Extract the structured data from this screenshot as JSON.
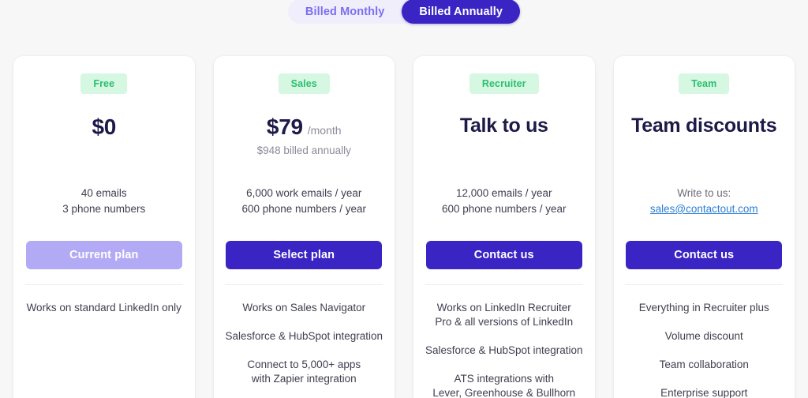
{
  "billing_toggle": {
    "options": [
      {
        "label": "Billed Monthly",
        "active": false
      },
      {
        "label": "Billed Annually",
        "active": true
      }
    ]
  },
  "colors": {
    "page_background": "#f7f7f8",
    "card_background": "#ffffff",
    "accent_primary": "#3a24c4",
    "accent_muted": "#b3aaf5",
    "badge_background": "#d6f7e2",
    "badge_text": "#2bbf6e",
    "heading_text": "#1d1a47",
    "body_text": "#3f3f50",
    "muted_text": "#8b8b99",
    "link": "#2b7fd4",
    "toggle_track": "#f0eefb",
    "toggle_inactive_text": "#7b6ff0",
    "divider": "#ededf1"
  },
  "plans": [
    {
      "badge": "Free",
      "price": "$0",
      "price_suffix": "",
      "price_sub": "",
      "quota_lines": [
        "40 emails",
        "3 phone numbers"
      ],
      "quota_note": "",
      "quota_link": "",
      "cta_label": "Current plan",
      "cta_state": "current",
      "features": [
        "Works on standard LinkedIn only"
      ]
    },
    {
      "badge": "Sales",
      "price": "$79",
      "price_suffix": "/month",
      "price_sub": "$948 billed annually",
      "quota_lines": [
        "6,000 work emails / year",
        "600 phone numbers / year"
      ],
      "quota_note": "",
      "quota_link": "",
      "cta_label": "Select plan",
      "cta_state": "primary",
      "features": [
        "Works on Sales Navigator",
        "Salesforce & HubSpot integration",
        "Connect to 5,000+ apps\nwith Zapier integration"
      ]
    },
    {
      "badge": "Recruiter",
      "price": "Talk to us",
      "price_suffix": "",
      "price_sub": "",
      "quota_lines": [
        "12,000 emails / year",
        "600 phone numbers / year"
      ],
      "quota_note": "",
      "quota_link": "",
      "cta_label": "Contact us",
      "cta_state": "primary",
      "features": [
        "Works on LinkedIn Recruiter\nPro & all versions of LinkedIn",
        "Salesforce & HubSpot integration",
        "ATS integrations with\nLever, Greenhouse & Bullhorn"
      ]
    },
    {
      "badge": "Team",
      "price": "Team discounts",
      "price_suffix": "",
      "price_sub": "",
      "quota_lines": [],
      "quota_note": "Write to us:",
      "quota_link": "sales@contactout.com",
      "cta_label": "Contact us",
      "cta_state": "primary",
      "features": [
        "Everything in Recruiter plus",
        "Volume discount",
        "Team collaboration",
        "Enterprise support"
      ]
    }
  ]
}
